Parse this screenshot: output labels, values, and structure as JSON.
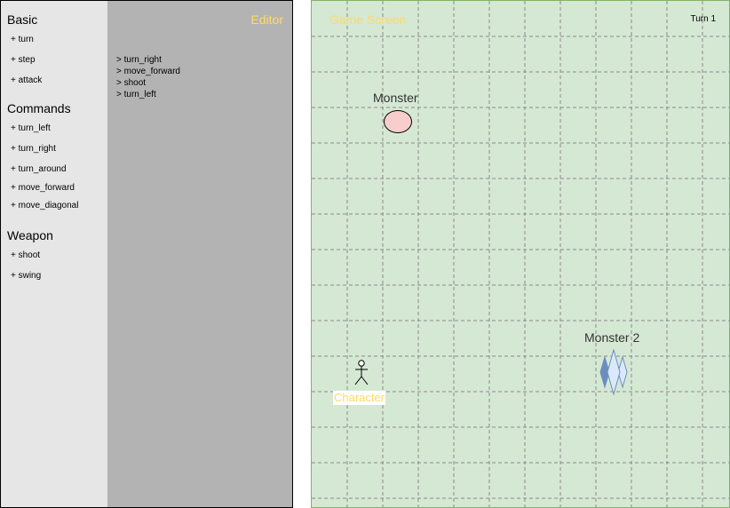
{
  "sidebar": {
    "sections": [
      {
        "title": "Basic",
        "items": [
          "+ turn",
          "+ step",
          "+ attack"
        ]
      },
      {
        "title": "Commands",
        "items": [
          "+ turn_left",
          "+ turn_right",
          "+ turn_around",
          "+ move_forward",
          "+ move_diagonal"
        ]
      },
      {
        "title": "Weapon",
        "items": [
          "+ shoot",
          "+ swing"
        ]
      }
    ]
  },
  "editor": {
    "title": "Editor",
    "lines": [
      "> turn_right",
      "> move_forward",
      "> shoot",
      "> turn_left"
    ]
  },
  "game": {
    "title": "Game Screen",
    "turn": "Turn 1",
    "monster1_label": "Monster",
    "monster2_label": "Monster 2",
    "character_label": "Character"
  },
  "colors": {
    "sidebar_bg": "#e6e6e6",
    "editor_bg": "#b3b3b3",
    "game_bg": "#d5e8d4",
    "title_accent": "#ffd966",
    "monster1_fill": "#f8cecc",
    "monster2_fill": "#dae8fc"
  }
}
